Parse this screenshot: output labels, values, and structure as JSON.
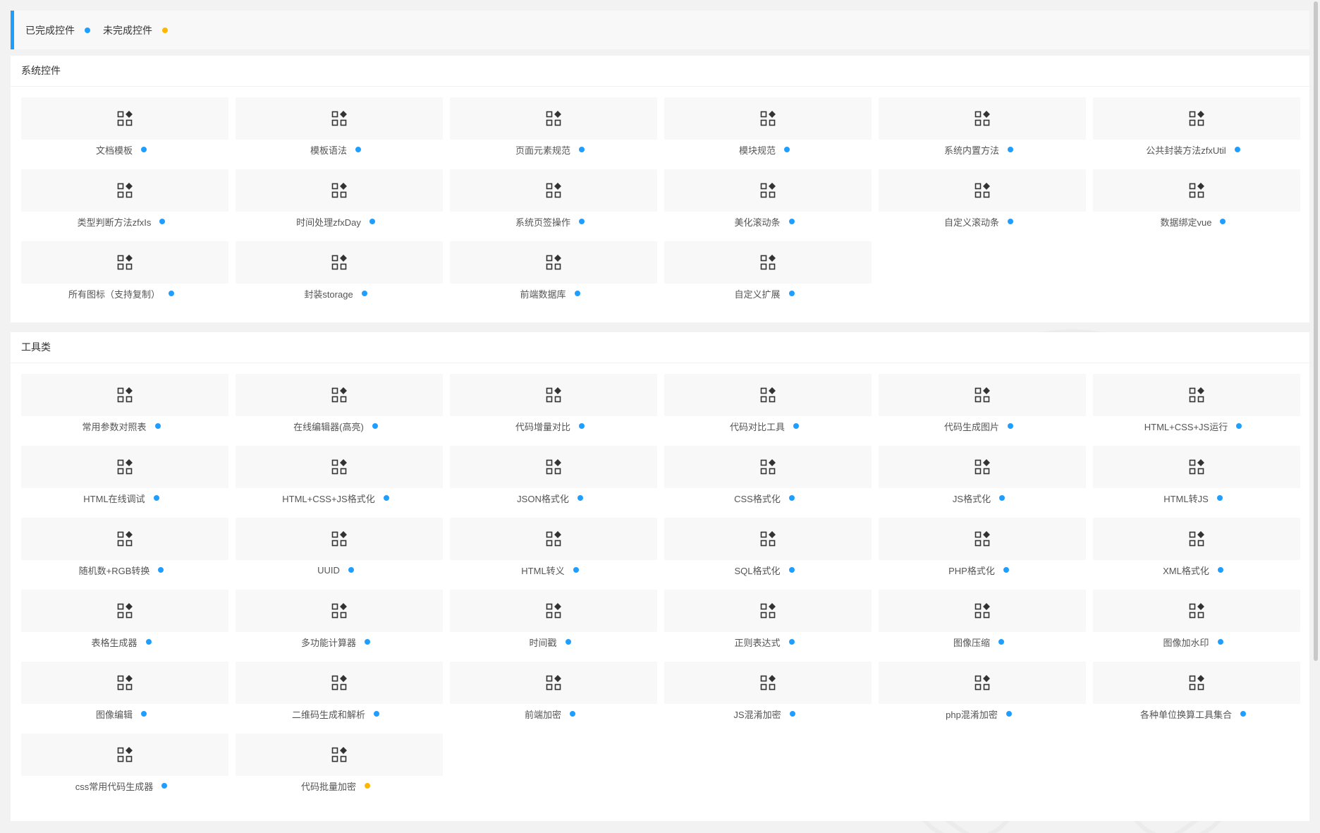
{
  "legend": {
    "done_label": "已完成控件",
    "todo_label": "未完成控件"
  },
  "colors": {
    "done": "#1e9fff",
    "todo": "#ffb800",
    "accent": "#1e9fff"
  },
  "icon": "widget-grid-icon",
  "sections": [
    {
      "title": "系统控件",
      "items": [
        {
          "label": "文档模板",
          "status": "done"
        },
        {
          "label": "模板语法",
          "status": "done"
        },
        {
          "label": "页面元素规范",
          "status": "done"
        },
        {
          "label": "模块规范",
          "status": "done"
        },
        {
          "label": "系统内置方法",
          "status": "done"
        },
        {
          "label": "公共封装方法zfxUtil",
          "status": "done"
        },
        {
          "label": "类型判断方法zfxIs",
          "status": "done"
        },
        {
          "label": "时间处理zfxDay",
          "status": "done"
        },
        {
          "label": "系统页签操作",
          "status": "done"
        },
        {
          "label": "美化滚动条",
          "status": "done"
        },
        {
          "label": "自定义滚动条",
          "status": "done"
        },
        {
          "label": "数据绑定vue",
          "status": "done"
        },
        {
          "label": "所有图标（支持复制）",
          "status": "done"
        },
        {
          "label": "封装storage",
          "status": "done"
        },
        {
          "label": "前端数据库",
          "status": "done"
        },
        {
          "label": "自定义扩展",
          "status": "done"
        }
      ]
    },
    {
      "title": "工具类",
      "items": [
        {
          "label": "常用参数对照表",
          "status": "done"
        },
        {
          "label": "在线编辑器(高亮)",
          "status": "done"
        },
        {
          "label": "代码增量对比",
          "status": "done"
        },
        {
          "label": "代码对比工具",
          "status": "done"
        },
        {
          "label": "代码生成图片",
          "status": "done"
        },
        {
          "label": "HTML+CSS+JS运行",
          "status": "done"
        },
        {
          "label": "HTML在线调试",
          "status": "done"
        },
        {
          "label": "HTML+CSS+JS格式化",
          "status": "done"
        },
        {
          "label": "JSON格式化",
          "status": "done"
        },
        {
          "label": "CSS格式化",
          "status": "done"
        },
        {
          "label": "JS格式化",
          "status": "done"
        },
        {
          "label": "HTML转JS",
          "status": "done"
        },
        {
          "label": "随机数+RGB转换",
          "status": "done"
        },
        {
          "label": "UUID",
          "status": "done"
        },
        {
          "label": "HTML转义",
          "status": "done"
        },
        {
          "label": "SQL格式化",
          "status": "done"
        },
        {
          "label": "PHP格式化",
          "status": "done"
        },
        {
          "label": "XML格式化",
          "status": "done"
        },
        {
          "label": "表格生成器",
          "status": "done"
        },
        {
          "label": "多功能计算器",
          "status": "done"
        },
        {
          "label": "时间戳",
          "status": "done"
        },
        {
          "label": "正则表达式",
          "status": "done"
        },
        {
          "label": "图像压缩",
          "status": "done"
        },
        {
          "label": "图像加水印",
          "status": "done"
        },
        {
          "label": "图像编辑",
          "status": "done"
        },
        {
          "label": "二维码生成和解析",
          "status": "done"
        },
        {
          "label": "前端加密",
          "status": "done"
        },
        {
          "label": "JS混淆加密",
          "status": "done"
        },
        {
          "label": "php混淆加密",
          "status": "done"
        },
        {
          "label": "各种单位换算工具集合",
          "status": "done"
        },
        {
          "label": "css常用代码生成器",
          "status": "done"
        },
        {
          "label": "代码批量加密",
          "status": "todo"
        }
      ]
    }
  ]
}
